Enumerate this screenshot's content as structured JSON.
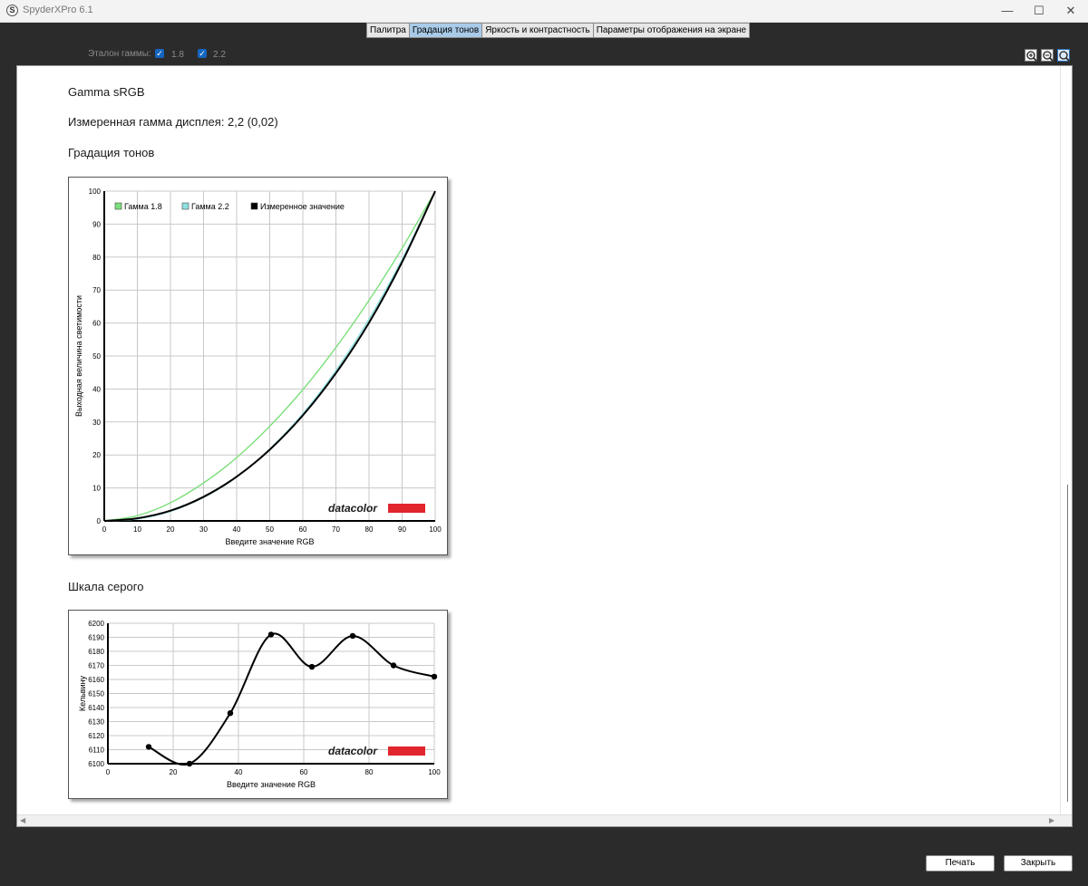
{
  "window": {
    "title": "SpyderXPro 6.1",
    "icon_letter": "S"
  },
  "tabs": [
    {
      "label": "Палитра",
      "active": false
    },
    {
      "label": "Градация тонов",
      "active": true
    },
    {
      "label": "Яркость и контрастность",
      "active": false
    },
    {
      "label": "Параметры отображения на экране",
      "active": false
    }
  ],
  "gamma_reference": {
    "label": "Эталон гаммы:",
    "options": [
      {
        "label": "1.8",
        "checked": true
      },
      {
        "label": "2.2",
        "checked": true
      }
    ]
  },
  "zoom_icons": [
    "zoom-in-icon",
    "zoom-out-icon",
    "zoom-fit-icon"
  ],
  "report": {
    "profile_name": "Gamma sRGB",
    "measured_gamma": "Измеренная гамма дисплея: 2,2 (0,02)",
    "tone_section_title": "Градация тонов",
    "gray_section_title": "Шкала серого"
  },
  "chart_data": [
    {
      "type": "line",
      "xlabel": "Введите значение RGB",
      "ylabel": "Выходная величина светимости",
      "xlim": [
        0,
        100
      ],
      "ylim": [
        0,
        100
      ],
      "x_ticks": [
        "0",
        "10",
        "20",
        "30",
        "40",
        "50",
        "60",
        "70",
        "80",
        "90",
        "100"
      ],
      "y_ticks": [
        "0",
        "10",
        "20",
        "30",
        "40",
        "50",
        "60",
        "70",
        "80",
        "90",
        "100"
      ],
      "grid": true,
      "legend_position": "top-left",
      "series": [
        {
          "name": "Гамма 1.8",
          "color": "#7de07d",
          "x": [
            0,
            10,
            20,
            30,
            40,
            50,
            60,
            70,
            80,
            90,
            100
          ],
          "y": [
            0,
            1.6,
            5.5,
            11.5,
            19.2,
            28.7,
            39.8,
            52.6,
            66.9,
            82.7,
            100
          ]
        },
        {
          "name": "Гамма 2.2",
          "color": "#8fe0e0",
          "x": [
            0,
            10,
            20,
            30,
            40,
            50,
            60,
            70,
            80,
            90,
            100
          ],
          "y": [
            0,
            0.6,
            2.9,
            7.1,
            13.3,
            21.8,
            32.5,
            45.6,
            61.2,
            79.3,
            100
          ]
        },
        {
          "name": "Измеренное значение",
          "color": "#000000",
          "x": [
            0,
            10,
            20,
            30,
            40,
            50,
            60,
            70,
            80,
            90,
            100
          ],
          "y": [
            0,
            0.8,
            3.1,
            7.3,
            13.4,
            21.6,
            32.0,
            44.8,
            60.1,
            78.5,
            100
          ]
        }
      ],
      "watermark": "datacolor"
    },
    {
      "type": "line",
      "xlabel": "Введите значение RGB",
      "ylabel": "Кельвину",
      "xlim": [
        0,
        100
      ],
      "ylim": [
        6100,
        6200
      ],
      "x_ticks": [
        "0",
        "20",
        "40",
        "60",
        "80",
        "100"
      ],
      "y_ticks": [
        "6100",
        "6110",
        "6120",
        "6130",
        "6140",
        "6150",
        "6160",
        "6170",
        "6180",
        "6190",
        "6200"
      ],
      "grid": true,
      "series": [
        {
          "color": "#000000",
          "x": [
            12.5,
            25,
            37.5,
            50,
            62.5,
            75,
            87.5,
            100
          ],
          "y": [
            6112,
            6100,
            6136,
            6192,
            6169,
            6191,
            6170,
            6162
          ]
        }
      ],
      "watermark": "datacolor"
    }
  ],
  "footer": {
    "print_label": "Печать",
    "close_label": "Закрыть"
  }
}
